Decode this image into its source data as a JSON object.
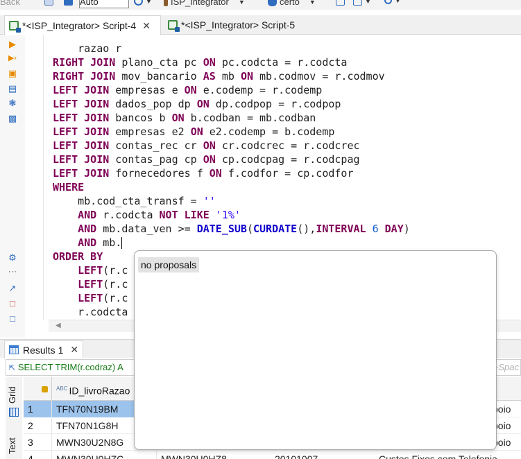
{
  "toolbar": {
    "back_label": "Back",
    "auto_value": "Auto",
    "connection_label": "ISP_Integrator",
    "database_label": "certo"
  },
  "tabs": [
    {
      "label": "*<ISP_Integrator> Script-4",
      "active": true
    },
    {
      "label": "*<ISP_Integrator> Script-5",
      "active": false
    }
  ],
  "editor": {
    "lines": [
      "    razao r",
      "RIGHT JOIN plano_cta pc ON pc.codcta = r.codcta",
      "RIGHT JOIN mov_bancario AS mb ON mb.codmov = r.codmov",
      "LEFT JOIN empresas e ON e.codemp = r.codemp",
      "LEFT JOIN dados_pop dp ON dp.codpop = r.codpop",
      "LEFT JOIN bancos b ON b.codban = mb.codban",
      "LEFT JOIN empresas e2 ON e2.codemp = b.codemp",
      "LEFT JOIN contas_rec cr ON cr.codcrec = r.codcrec",
      "LEFT JOIN contas_pag cp ON cp.codcpag = r.codcpag",
      "LEFT JOIN fornecedores f ON f.codfor = cp.codfor",
      "WHERE",
      "    mb.cod_cta_transf = ''",
      "    AND r.codcta NOT LIKE '1%'",
      "    AND mb.data_ven >= DATE_SUB(CURDATE(),INTERVAL 6 DAY)",
      "    AND mb.",
      "ORDER BY",
      "    LEFT(r.c",
      "    LEFT(r.c",
      "    LEFT(r.c",
      "    r.codcta"
    ]
  },
  "autocomplete": {
    "message": "no proposals"
  },
  "results": {
    "tab_label": "Results 1",
    "filter_text": "SELECT TRIM(r.codraz) A",
    "filter_hint": "l+Spac",
    "view_tabs": {
      "grid": "Grid",
      "text": "Text"
    },
    "column_header": "ID_livroRazao",
    "column_type": "ABC",
    "rows": [
      {
        "n": "1",
        "id": "TFN70N19BM",
        "c2": "",
        "c3": "",
        "c4": "",
        "right": "poio",
        "selected": true
      },
      {
        "n": "2",
        "id": "TFN70N1G8H",
        "c2": "",
        "c3": "",
        "c4": "",
        "right": "poio",
        "selected": false
      },
      {
        "n": "3",
        "id": "MWN30U2N8G",
        "c2": "",
        "c3": "",
        "c4": "",
        "right": "poio",
        "selected": false
      },
      {
        "n": "4",
        "id": "MWN30U0HZC",
        "c2": "MWN30U0HZ8",
        "c3": "20101007",
        "c4": "Custos Fixos com Telefonia",
        "right": "",
        "selected": false
      }
    ]
  },
  "colors": {
    "keyword": "#7f0055",
    "string": "#2a00ff",
    "number": "#125bd6",
    "current_line": "#e8f2fe",
    "selection": "#9cc3ec"
  }
}
